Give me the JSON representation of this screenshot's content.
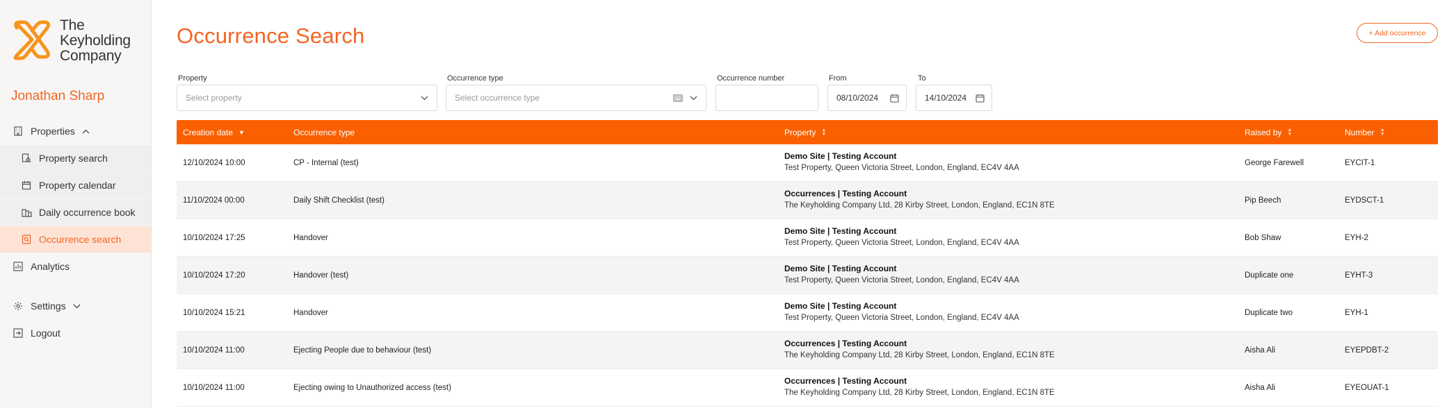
{
  "brand": {
    "line1": "The",
    "line2": "Keyholding",
    "line3": "Company",
    "logo_color": "#f7941d"
  },
  "user": {
    "name": "Jonathan Sharp"
  },
  "nav": {
    "properties": "Properties",
    "property_search": "Property search",
    "property_calendar": "Property calendar",
    "daily_book": "Daily occurrence book",
    "occurrence_search": "Occurrence search",
    "analytics": "Analytics",
    "settings": "Settings",
    "logout": "Logout"
  },
  "page": {
    "title": "Occurrence Search",
    "add_button": "+ Add occurrence",
    "accent": "#f26522",
    "header_bg": "#fa6000"
  },
  "filters": {
    "property_label": "Property",
    "property_placeholder": "Select property",
    "type_label": "Occurrence type",
    "type_placeholder": "Select occurrence type",
    "number_label": "Occurrence number",
    "number_value": "",
    "from_label": "From",
    "from_value": "08/10/2024",
    "to_label": "To",
    "to_value": "14/10/2024"
  },
  "table": {
    "headers": {
      "creation_date": "Creation date",
      "occurrence_type": "Occurrence type",
      "property": "Property",
      "raised_by": "Raised by",
      "number": "Number"
    },
    "rows": [
      {
        "date": "12/10/2024 10:00",
        "type": "CP - Internal (test)",
        "property_title": "Demo Site | Testing Account",
        "property_address": "Test Property, Queen Victoria Street, London, England, EC4V 4AA",
        "raised_by": "George Farewell",
        "number": "EYCIT-1"
      },
      {
        "date": "11/10/2024 00:00",
        "type": "Daily Shift Checklist (test)",
        "property_title": "Occurrences | Testing Account",
        "property_address": "The Keyholding Company Ltd, 28 Kirby Street, London, England, EC1N 8TE",
        "raised_by": "Pip Beech",
        "number": "EYDSCT-1"
      },
      {
        "date": "10/10/2024 17:25",
        "type": "Handover",
        "property_title": "Demo Site | Testing Account",
        "property_address": "Test Property, Queen Victoria Street, London, England, EC4V 4AA",
        "raised_by": "Bob Shaw",
        "number": "EYH-2"
      },
      {
        "date": "10/10/2024 17:20",
        "type": "Handover (test)",
        "property_title": "Demo Site | Testing Account",
        "property_address": "Test Property, Queen Victoria Street, London, England, EC4V 4AA",
        "raised_by": "Duplicate one",
        "number": "EYHT-3"
      },
      {
        "date": "10/10/2024 15:21",
        "type": "Handover",
        "property_title": "Demo Site | Testing Account",
        "property_address": "Test Property, Queen Victoria Street, London, England, EC4V 4AA",
        "raised_by": "Duplicate two",
        "number": "EYH-1"
      },
      {
        "date": "10/10/2024 11:00",
        "type": "Ejecting People due to behaviour (test)",
        "property_title": "Occurrences | Testing Account",
        "property_address": "The Keyholding Company Ltd, 28 Kirby Street, London, England, EC1N 8TE",
        "raised_by": "Aisha Ali",
        "number": "EYEPDBT-2"
      },
      {
        "date": "10/10/2024 11:00",
        "type": "Ejecting owing to Unauthorized access (test)",
        "property_title": "Occurrences | Testing Account",
        "property_address": "The Keyholding Company Ltd, 28 Kirby Street, London, England, EC1N 8TE",
        "raised_by": "Aisha Ali",
        "number": "EYEOUAT-1"
      }
    ]
  }
}
